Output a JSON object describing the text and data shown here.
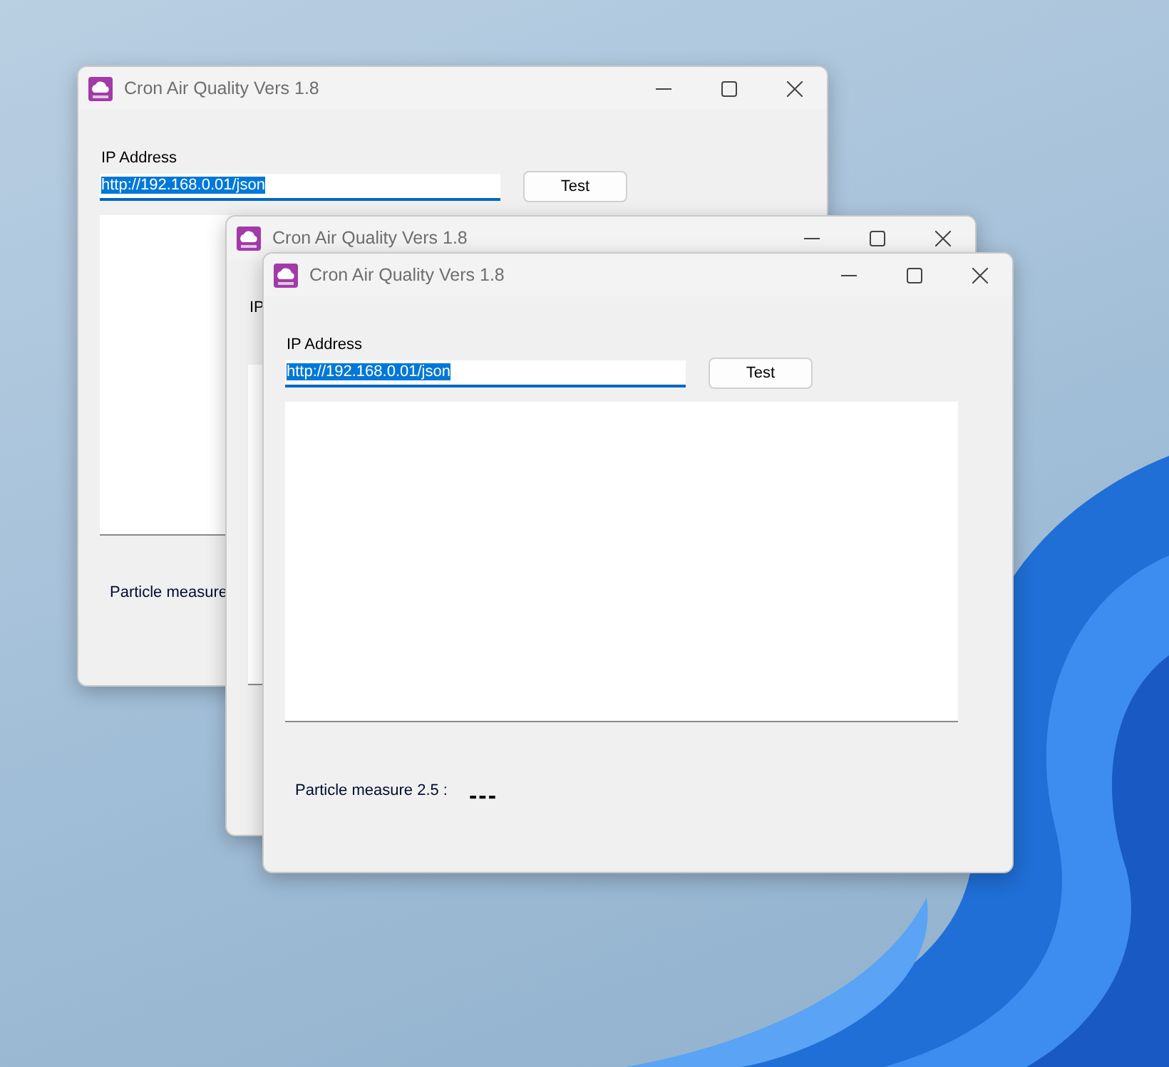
{
  "windows": [
    {
      "title": "Cron Air Quality Vers 1.8",
      "ip_label": "IP Address",
      "url": "http://192.168.0.01/json",
      "test_button": "Test",
      "particle_label": "Particle measure"
    },
    {
      "title": "Cron Air Quality Vers 1.8",
      "ip_label": "IP"
    },
    {
      "title": "Cron Air Quality Vers 1.8",
      "ip_label": "IP Address",
      "url": "http://192.168.0.01/json",
      "test_button": "Test",
      "particle_label": "Particle measure 2.5 :",
      "reading": "---"
    }
  ]
}
